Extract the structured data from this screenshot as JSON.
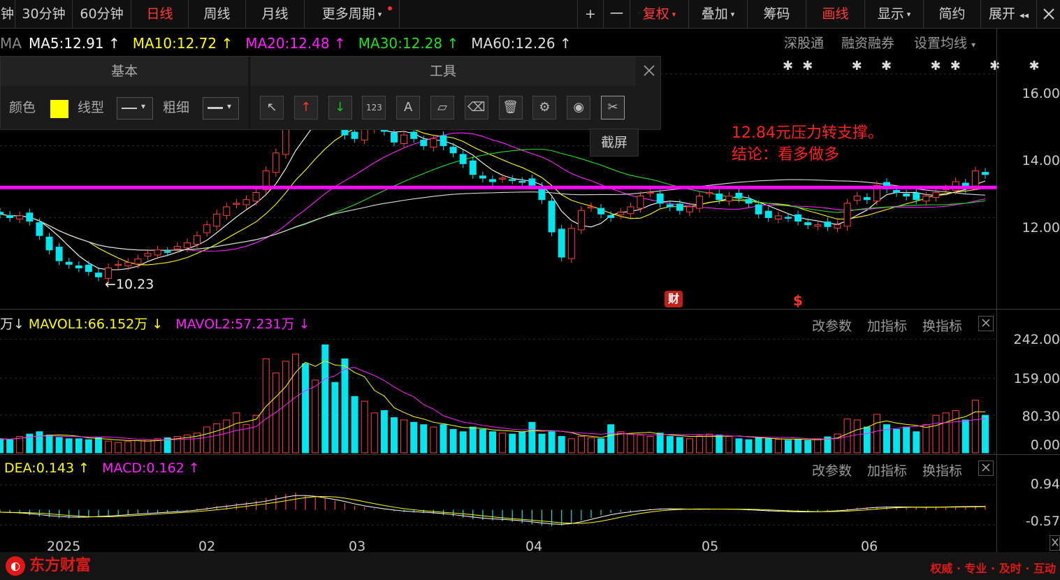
{
  "topbar": {
    "periods": [
      "钟",
      "30分钟",
      "60分钟",
      "日线",
      "周线",
      "月线",
      "更多周期"
    ],
    "active_period": "日线",
    "tools": [
      "+",
      "一",
      "复权",
      "叠加",
      "筹码",
      "画线",
      "显示",
      "简约",
      "展开"
    ],
    "dropdown_mark": "▾",
    "collapse_mark": "◂◂"
  },
  "ma_legend": {
    "prefix": "MA",
    "items": [
      {
        "label": "MA5:12.91",
        "arrow": "↑",
        "color": "#ffffff"
      },
      {
        "label": "MA10:12.72",
        "arrow": "↑",
        "color": "#ffff00"
      },
      {
        "label": "MA20:12.48",
        "arrow": "↑",
        "color": "#ff20ff"
      },
      {
        "label": "MA30:12.28",
        "arrow": "↑",
        "color": "#20e020"
      },
      {
        "label": "MA60:12.26",
        "arrow": "↑",
        "color": "#dddddd"
      }
    ],
    "links": [
      "深股通",
      "融资融券",
      "设置均线"
    ]
  },
  "draw_panel": {
    "tab_basic": "基本",
    "tab_tools": "工具",
    "color_label": "颜色",
    "color_value": "#ffff00",
    "line_type_label": "线型",
    "thickness_label": "粗细",
    "tool_icons": [
      "cursor-icon",
      "arrow-up-icon",
      "arrow-down-icon",
      "number-icon",
      "text-icon",
      "ruler-icon",
      "eraser-icon",
      "trash-icon",
      "gear-icon",
      "eye-icon",
      "screenshot-icon"
    ],
    "tool_glyphs": [
      "↖",
      "↑",
      "↓",
      "123",
      "A",
      "▱",
      "⌫",
      "🗑",
      "⚙",
      "◉",
      "✂"
    ],
    "tooltip": "截屏"
  },
  "annotation": {
    "line1": "12.84元压力转支撑。",
    "line2": "结论：看多做多",
    "low_label": "←10.23",
    "badge_fin": "财",
    "badge_dollar": "$"
  },
  "vol_legend": {
    "prefix": "万↓",
    "items": [
      {
        "label": "MAVOL1:66.152万",
        "arrow": "↓",
        "color": "#ffff00"
      },
      {
        "label": "MAVOL2:57.231万",
        "arrow": "↓",
        "color": "#ff20ff"
      }
    ]
  },
  "macd_legend": {
    "items": [
      {
        "label": "DEA:0.143",
        "arrow": "↑",
        "color": "#ffff00"
      },
      {
        "label": "MACD:0.162",
        "arrow": "↑",
        "color": "#ff20ff"
      }
    ]
  },
  "panel_links": [
    "改参数",
    "加指标",
    "换指标"
  ],
  "footer": {
    "logo": "东方财富",
    "slogan": "权威 · 专业 · 及时 · 互动"
  },
  "chart_data": {
    "type": "candlestick",
    "price_axis": {
      "ticks": [
        12.0,
        14.0,
        16.0
      ],
      "tick_labels": [
        "12.00",
        "14.00",
        "16.00"
      ],
      "range": [
        9.5,
        16.5
      ]
    },
    "volume_axis": {
      "ticks": [
        0,
        80.3,
        159,
        242
      ],
      "tick_labels": [
        "0.00",
        "80.30",
        "159.00",
        "242.00"
      ],
      "range": [
        0,
        250
      ]
    },
    "macd_axis": {
      "ticks": [
        -0.57,
        0.94
      ],
      "tick_labels": [
        "-0.57",
        "0.94"
      ],
      "range": [
        -0.8,
        1.2
      ]
    },
    "x_labels": [
      "2025",
      "02",
      "03",
      "04",
      "05",
      "06"
    ],
    "x_label_index": [
      6,
      22,
      37,
      55,
      74,
      90
    ],
    "horizontal_line": {
      "value": 12.84,
      "color": "#ff00ff"
    },
    "colors": {
      "up": "#ff4040",
      "down": "#00e5ee",
      "ma5": "#ffffff",
      "ma10": "#ffff00",
      "ma20": "#ff20ff",
      "ma30": "#20e020",
      "ma60": "#dddddd"
    },
    "low_point": {
      "index": 10,
      "value": 10.23
    },
    "closes": [
      12.1,
      12.0,
      12.05,
      11.9,
      11.5,
      11.1,
      10.8,
      10.7,
      10.6,
      10.5,
      10.35,
      10.6,
      10.7,
      10.75,
      10.85,
      11.0,
      11.1,
      11.05,
      11.2,
      11.3,
      11.5,
      11.8,
      12.1,
      12.3,
      12.4,
      12.5,
      12.7,
      13.3,
      13.8,
      14.5,
      15.0,
      14.6,
      15.2,
      15.1,
      14.8,
      14.3,
      14.2,
      14.5,
      14.7,
      14.4,
      14.1,
      14.3,
      14.2,
      14.0,
      14.2,
      14.0,
      13.8,
      13.5,
      13.2,
      13.1,
      13.0,
      13.1,
      13.05,
      13.0,
      12.9,
      12.5,
      11.6,
      10.9,
      11.7,
      12.2,
      12.3,
      12.1,
      12.0,
      12.15,
      12.3,
      12.6,
      12.7,
      12.4,
      12.3,
      12.2,
      12.3,
      12.6,
      12.7,
      12.5,
      12.6,
      12.55,
      12.4,
      12.1,
      12.0,
      12.05,
      12.0,
      11.9,
      11.8,
      11.8,
      11.75,
      11.8,
      12.4,
      12.6,
      12.5,
      12.9,
      12.8,
      12.7,
      12.6,
      12.5,
      12.6,
      12.7,
      12.8,
      13.0,
      12.8,
      13.3,
      13.2
    ],
    "volumes": [
      30,
      28,
      35,
      40,
      45,
      38,
      33,
      30,
      30,
      28,
      32,
      25,
      22,
      24,
      26,
      28,
      30,
      32,
      35,
      38,
      42,
      55,
      62,
      70,
      85,
      60,
      80,
      200,
      170,
      195,
      210,
      190,
      155,
      230,
      150,
      200,
      120,
      110,
      85,
      90,
      75,
      70,
      65,
      60,
      55,
      60,
      50,
      45,
      55,
      50,
      45,
      42,
      40,
      45,
      65,
      40,
      45,
      35,
      30,
      35,
      32,
      30,
      60,
      45,
      40,
      38,
      35,
      42,
      35,
      33,
      30,
      36,
      40,
      38,
      35,
      30,
      28,
      32,
      30,
      29,
      27,
      28,
      26,
      30,
      34,
      40,
      72,
      70,
      55,
      82,
      60,
      50,
      55,
      45,
      60,
      80,
      85,
      90,
      70,
      112,
      80
    ],
    "macd_hist": [
      -0.1,
      -0.12,
      -0.15,
      -0.2,
      -0.25,
      -0.28,
      -0.3,
      -0.32,
      -0.3,
      -0.28,
      -0.26,
      -0.24,
      -0.2,
      -0.18,
      -0.15,
      -0.12,
      -0.1,
      -0.08,
      -0.05,
      -0.02,
      0.05,
      0.1,
      0.15,
      0.2,
      0.25,
      0.3,
      0.35,
      0.45,
      0.55,
      0.6,
      0.65,
      0.55,
      0.5,
      0.45,
      0.35,
      0.25,
      0.15,
      0.1,
      0.05,
      -0.02,
      -0.05,
      -0.08,
      -0.1,
      -0.12,
      -0.15,
      -0.2,
      -0.25,
      -0.3,
      -0.35,
      -0.38,
      -0.4,
      -0.42,
      -0.45,
      -0.5,
      -0.55,
      -0.6,
      -0.62,
      -0.6,
      -0.5,
      -0.4,
      -0.3,
      -0.2,
      -0.12,
      -0.08,
      -0.05,
      0.02,
      0.04,
      0.05,
      0.04,
      0.03,
      0.02,
      0.03,
      0.04,
      0.03,
      0.02,
      0.01,
      -0.02,
      -0.04,
      -0.06,
      -0.07,
      -0.08,
      -0.09,
      -0.08,
      -0.06,
      -0.04,
      -0.02,
      0.04,
      0.08,
      0.1,
      0.12,
      0.13,
      0.12,
      0.11,
      0.1,
      0.11,
      0.12,
      0.13,
      0.14,
      0.13,
      0.15,
      0.16
    ]
  }
}
